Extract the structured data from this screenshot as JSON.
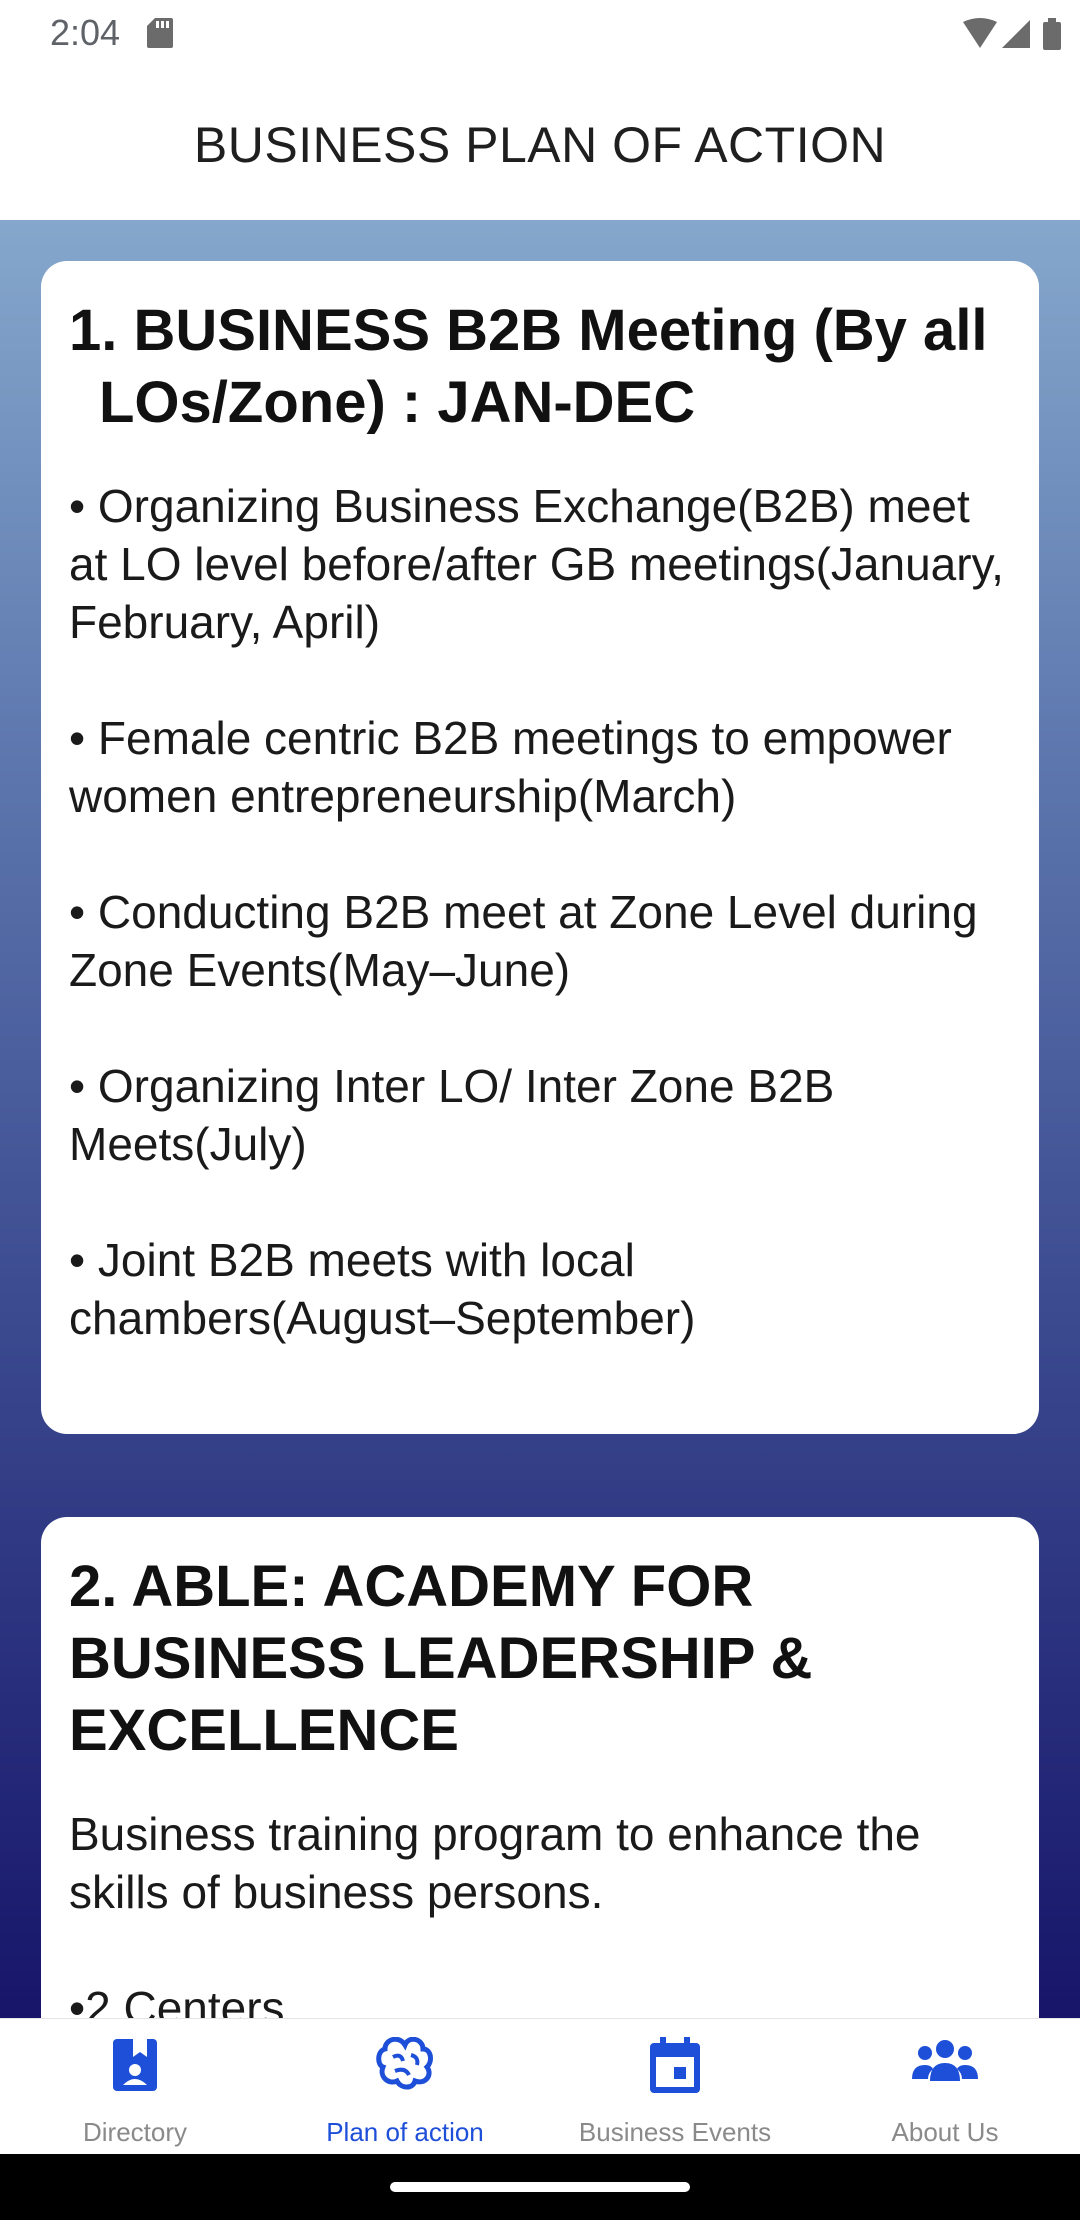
{
  "status": {
    "time": "2:04"
  },
  "header": {
    "title": "BUSINESS PLAN OF ACTION"
  },
  "cards": [
    {
      "title": "1. BUSINESS B2B Meeting (By all LOs/Zone) : JAN-DEC",
      "bullets": [
        "• Organizing Business Exchange(B2B) meet at LO level before/after GB meetings(January, February, April)",
        "• Female centric B2B meetings to empower women entrepreneurship(March)",
        "• Conducting B2B meet at Zone Level during Zone Events(May–June)",
        "• Organizing Inter LO/ Inter Zone B2B Meets(July)",
        "• Joint B2B meets with local chambers(August–September)"
      ]
    },
    {
      "title": "2. ABLE: ACADEMY FOR BUSINESS LEADERSHIP & EXCELLENCE",
      "text": "Business training program to enhance the skills of business persons.",
      "bullets": [
        "•2 Centers"
      ]
    }
  ],
  "nav": {
    "items": [
      {
        "label": "Directory",
        "icon": "directory-icon"
      },
      {
        "label": "Plan of action",
        "icon": "brain-icon"
      },
      {
        "label": "Business Events",
        "icon": "calendar-icon"
      },
      {
        "label": "About Us",
        "icon": "people-icon"
      }
    ],
    "active": "Plan of action"
  },
  "colors": {
    "accent": "#1d4fd8",
    "gradient_top": "#85a7cc",
    "gradient_bottom": "#17156a"
  }
}
